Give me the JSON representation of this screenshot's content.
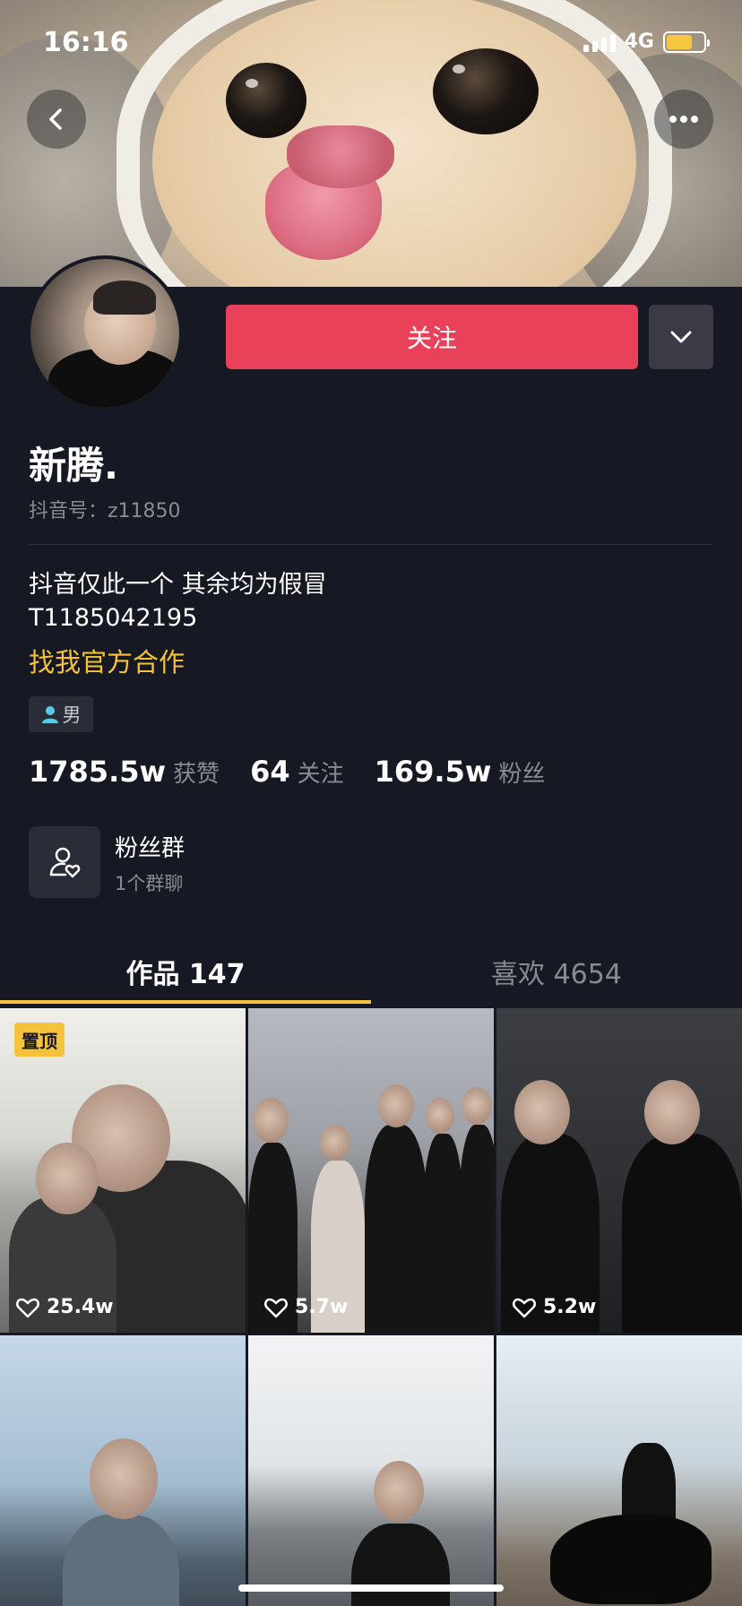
{
  "status_bar": {
    "time": "16:16",
    "network": "4G",
    "battery_level": 0.7,
    "battery_color": "#f7c640"
  },
  "header": {
    "back_icon": "chevron-left-icon",
    "more_icon": "more-horizontal-icon"
  },
  "profile": {
    "follow_label": "关注",
    "follow_color": "#e9415a",
    "name": "新腾.",
    "douyin_id": "抖音号：z11850",
    "bio_line1": "抖音仅此一个 其余均为假冒",
    "bio_line2": "T1185042195",
    "bio_link": "找我官方合作",
    "gender": "男"
  },
  "stats": [
    {
      "value": "1785.5w",
      "label": "获赞"
    },
    {
      "value": "64",
      "label": "关注"
    },
    {
      "value": "169.5w",
      "label": "粉丝"
    }
  ],
  "fans_group": {
    "title": "粉丝群",
    "subtitle": "1个群聊"
  },
  "tabs": [
    {
      "label": "作品 147",
      "active": true
    },
    {
      "label": "喜欢 4654",
      "active": false
    }
  ],
  "accent_color": "#f5c33b",
  "videos": [
    {
      "likes": "25.4w",
      "pinned": "置顶"
    },
    {
      "likes": "5.7w"
    },
    {
      "likes": "5.2w"
    },
    {
      "likes": ""
    },
    {
      "likes": ""
    },
    {
      "likes": ""
    }
  ]
}
